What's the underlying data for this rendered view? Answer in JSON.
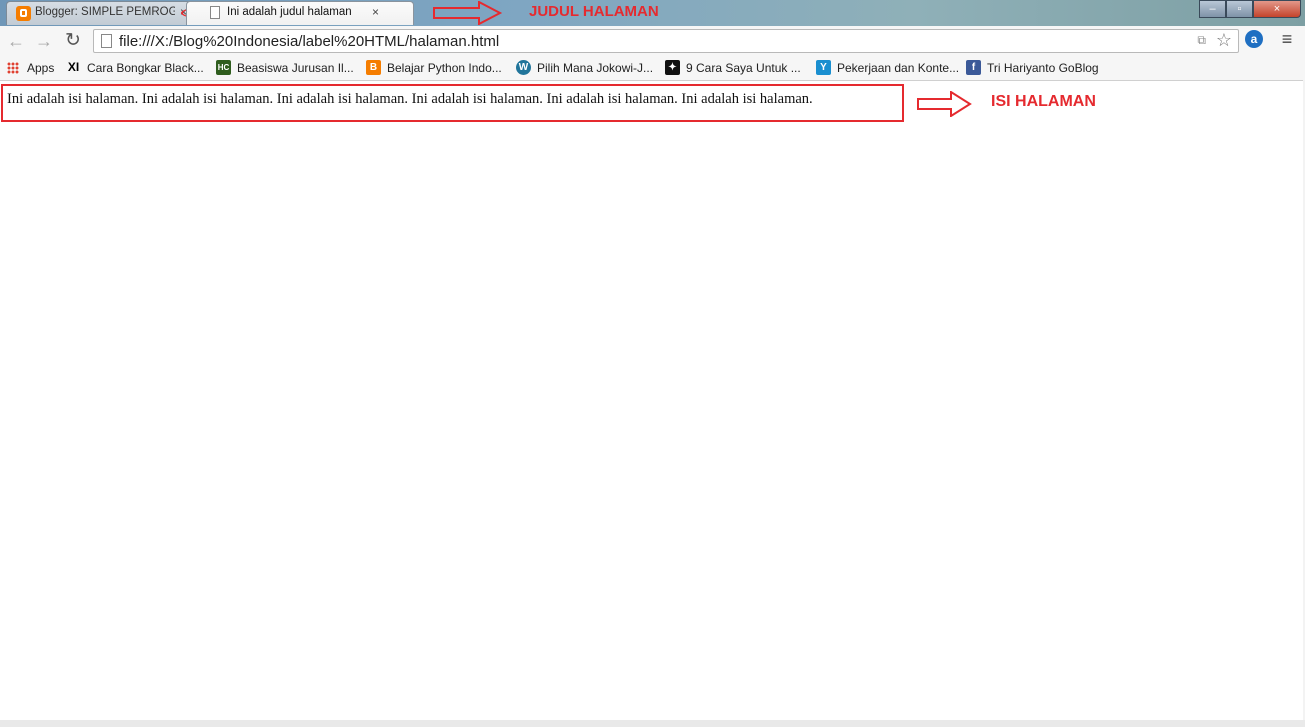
{
  "window": {
    "tabs": [
      {
        "label": "Blogger: SIMPLE PEMROG",
        "close": "×",
        "icon": "blogger-icon"
      },
      {
        "label": "Ini adalah judul halaman",
        "close": "×",
        "icon": "page-icon"
      }
    ],
    "controls": {
      "minimize": "–",
      "maximize": "▫",
      "close": "×"
    }
  },
  "toolbar": {
    "back": "←",
    "forward": "→",
    "reload": "↻",
    "url": "file:///X:/Blog%20Indonesia/label%20HTML/halaman.html",
    "star": "☆",
    "translate": "⧉",
    "extension": "a",
    "menu": "≡"
  },
  "bookmarks": [
    {
      "label": "Apps",
      "icon": "apps-grid-icon"
    },
    {
      "label": "Cara Bongkar Black...",
      "icon": "xi-icon",
      "glyph": "XI"
    },
    {
      "label": "Beasiswa Jurusan Il...",
      "icon": "hc-icon",
      "glyph": "HC"
    },
    {
      "label": "Belajar Python Indo...",
      "icon": "blogger-icon",
      "glyph": "B"
    },
    {
      "label": "Pilih Mana Jokowi-J...",
      "icon": "wordpress-icon",
      "glyph": "W"
    },
    {
      "label": "9 Cara Saya Untuk ...",
      "icon": "puzzle-icon",
      "glyph": "✦"
    },
    {
      "label": "Pekerjaan dan Konte...",
      "icon": "y-icon",
      "glyph": "Y"
    },
    {
      "label": "Tri Hariyanto GoBlog",
      "icon": "facebook-icon",
      "glyph": "f"
    }
  ],
  "page": {
    "content": "Ini adalah isi halaman. Ini adalah isi halaman. Ini adalah isi halaman. Ini adalah isi halaman. Ini adalah isi halaman. Ini adalah isi halaman."
  },
  "annotations": {
    "title_label": "JUDUL HALAMAN",
    "content_label": "ISI HALAMAN",
    "color": "#e52a2f"
  }
}
